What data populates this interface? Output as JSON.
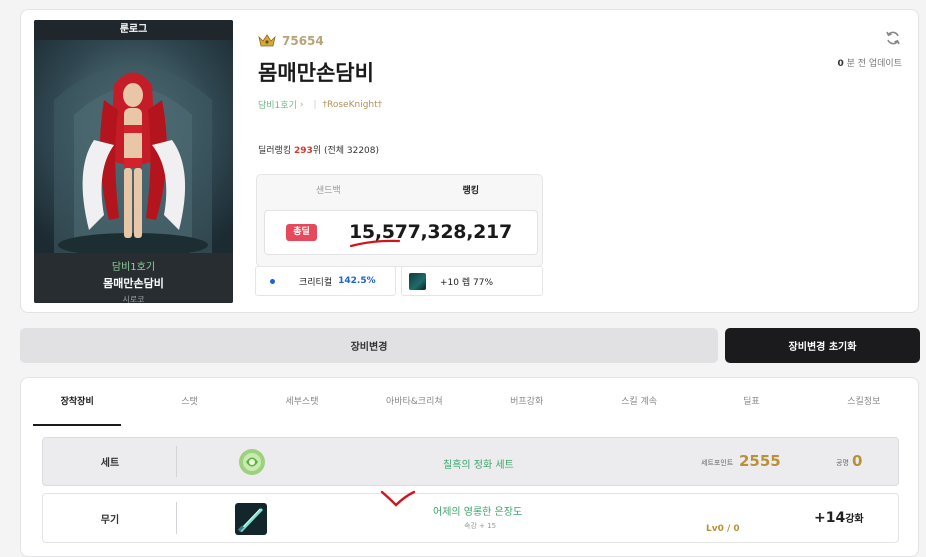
{
  "profile": {
    "portrait": {
      "header": "룬로그",
      "guild": "담비1호기",
      "name": "몸매만손담비",
      "job": "시로코"
    },
    "fame": "75654",
    "name": "몸매만손담비",
    "guild": "담비1호기",
    "adventure": "†RoseKnight†",
    "update": {
      "count": "0",
      "label": "분 전 업데이트"
    },
    "rank": {
      "prefix": "딜러랭킹",
      "value": "293",
      "suffix": "위 (전체 32208)"
    },
    "damage": {
      "tabs": [
        "샌드백",
        "랭킹"
      ],
      "badge": "총딜",
      "value": "15,577,328,217"
    },
    "buffs": {
      "crit_label": "크리티컬",
      "crit_value": "142.5%",
      "level_text": "+10 렙 77%"
    }
  },
  "buttons": {
    "change": "장비변경",
    "reset": "장비변경 초기화"
  },
  "tabs": [
    "장착장비",
    "스탯",
    "세부스탯",
    "아바타&크리쳐",
    "버프강화",
    "스킬 계속",
    "딜표",
    "스킬정보"
  ],
  "set_row": {
    "label": "세트",
    "name": "칠흑의 정화 세트",
    "point_label": "세트포인트",
    "point_value": "2555",
    "atk_label": "공명",
    "atk_value": "0"
  },
  "weapon_row": {
    "label": "무기",
    "name": "어제의 영롱한 은장도",
    "sub": "속강 + 15",
    "level": "Lv0 / 0",
    "reinforce": "+14",
    "reinforce_unit": "강화"
  },
  "colors": {
    "accent_red": "#e5495b",
    "fame_gold": "#b8a37a",
    "set_green": "#3aa66a",
    "crit_blue": "#1e62d6"
  }
}
